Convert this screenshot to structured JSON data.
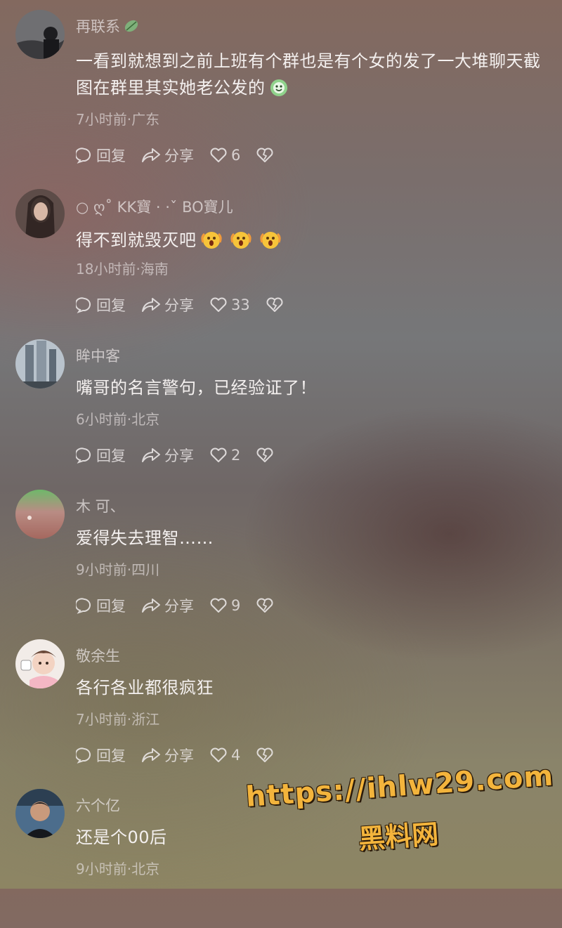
{
  "actions": {
    "reply_label": "回复",
    "share_label": "分享"
  },
  "comments": [
    {
      "username": "再联系",
      "text": "一看到就想到之前上班有个群也是有个女的发了一大堆聊天截图在群里其实她老公发的",
      "meta": "7小时前·广东",
      "likes": "6"
    },
    {
      "username": "○ ღ˚ KK寶 · ·ˇ BO寶儿",
      "text": "得不到就毁灭吧",
      "meta": "18小时前·海南",
      "likes": "33"
    },
    {
      "username": "眸中客",
      "text": "嘴哥的名言警句，已经验证了！",
      "meta": "6小时前·北京",
      "likes": "2"
    },
    {
      "username": "木 可、",
      "text": "爱得失去理智……",
      "meta": "9小时前·四川",
      "likes": "9"
    },
    {
      "username": "敬余生",
      "text": "各行各业都很疯狂",
      "meta": "7小时前·浙江",
      "likes": "4"
    },
    {
      "username": "六个亿",
      "text": "还是个00后",
      "meta": "9小时前·北京",
      "likes": ""
    }
  ],
  "watermark": {
    "url": "https://ihlw29.com",
    "name": "黑料网"
  },
  "icons": {
    "reply": "reply-bubble-icon",
    "share": "share-arrow-icon",
    "like": "heart-icon",
    "dislike": "broken-heart-icon",
    "emoji_face": "smiling-face-emoji-icon",
    "emoji_shock": "shocked-face-emoji-icon"
  },
  "colors": {
    "watermark": "#f3b43c",
    "text": "#f4f0ef"
  }
}
